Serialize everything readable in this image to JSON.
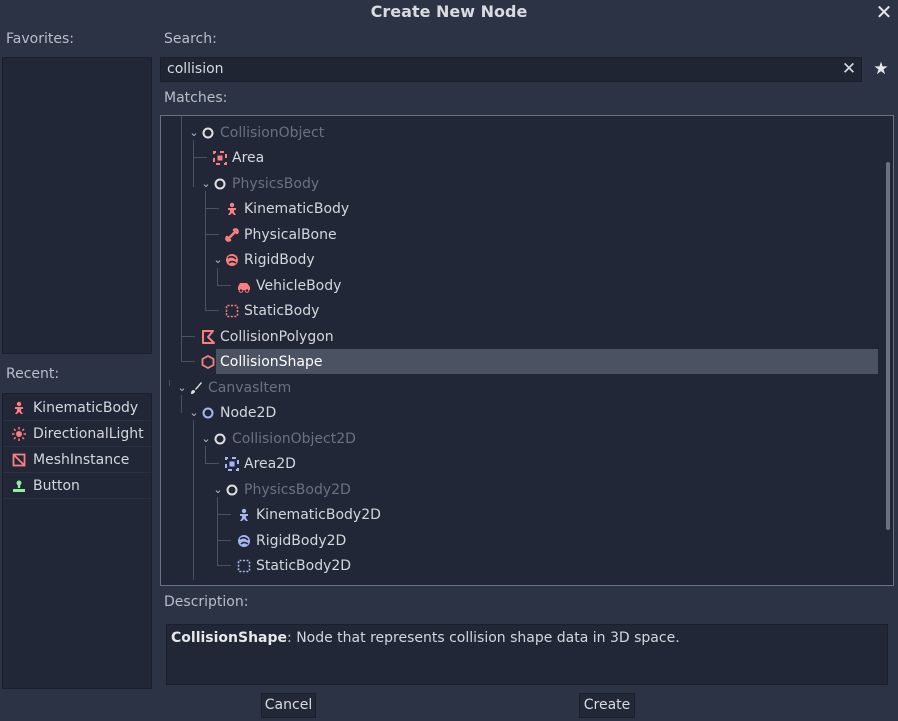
{
  "window": {
    "title": "Create New Node"
  },
  "favorites": {
    "label": "Favorites:"
  },
  "recent": {
    "label": "Recent:",
    "items": [
      {
        "label": "KinematicBody",
        "icon": "kinematic-body-icon",
        "color": "#fc7f7f"
      },
      {
        "label": "DirectionalLight",
        "icon": "directional-light-icon",
        "color": "#fc7f7f"
      },
      {
        "label": "MeshInstance",
        "icon": "mesh-instance-icon",
        "color": "#fc7f7f"
      },
      {
        "label": "Button",
        "icon": "button-icon",
        "color": "#8eef97"
      }
    ]
  },
  "search": {
    "label": "Search:",
    "value": "collision"
  },
  "matches": {
    "label": "Matches:",
    "items": [
      {
        "label": "CollisionObject",
        "icon": "circle-outline-icon",
        "disabled": true,
        "expanded": true
      },
      {
        "label": "Area",
        "icon": "area-icon",
        "disabled": false
      },
      {
        "label": "PhysicsBody",
        "icon": "circle-outline-icon",
        "disabled": true,
        "expanded": true
      },
      {
        "label": "KinematicBody",
        "icon": "kinematic-body-icon",
        "disabled": false
      },
      {
        "label": "PhysicalBone",
        "icon": "physical-bone-icon",
        "disabled": false
      },
      {
        "label": "RigidBody",
        "icon": "rigid-body-icon",
        "disabled": false,
        "expanded": true
      },
      {
        "label": "VehicleBody",
        "icon": "vehicle-body-icon",
        "disabled": false
      },
      {
        "label": "StaticBody",
        "icon": "static-body-icon",
        "disabled": false
      },
      {
        "label": "CollisionPolygon",
        "icon": "collision-polygon-icon",
        "disabled": false
      },
      {
        "label": "CollisionShape",
        "icon": "collision-shape-icon",
        "disabled": false,
        "selected": true
      },
      {
        "label": "CanvasItem",
        "icon": "brush-icon",
        "disabled": true,
        "expanded": true
      },
      {
        "label": "Node2D",
        "icon": "circle-outline-icon",
        "disabled": false,
        "expanded": true
      },
      {
        "label": "CollisionObject2D",
        "icon": "circle-outline-icon",
        "disabled": true,
        "expanded": true
      },
      {
        "label": "Area2D",
        "icon": "area-2d-icon",
        "disabled": false
      },
      {
        "label": "PhysicsBody2D",
        "icon": "circle-outline-icon",
        "disabled": true,
        "expanded": true
      },
      {
        "label": "KinematicBody2D",
        "icon": "kinematic-body-2d-icon",
        "disabled": false
      },
      {
        "label": "RigidBody2D",
        "icon": "rigid-body-2d-icon",
        "disabled": false
      },
      {
        "label": "StaticBody2D",
        "icon": "static-body-2d-icon",
        "disabled": false
      }
    ]
  },
  "description": {
    "label": "Description:",
    "node_name": "CollisionShape",
    "text": ": Node that represents collision shape data in 3D space."
  },
  "buttons": {
    "cancel": "Cancel",
    "create": "Create"
  },
  "colors": {
    "node3d": "#fc7f7f",
    "node2d": "#a5b7f3",
    "control": "#8eef97",
    "background": "#2c3345",
    "panel": "#212736",
    "selected": "#4b5262"
  }
}
